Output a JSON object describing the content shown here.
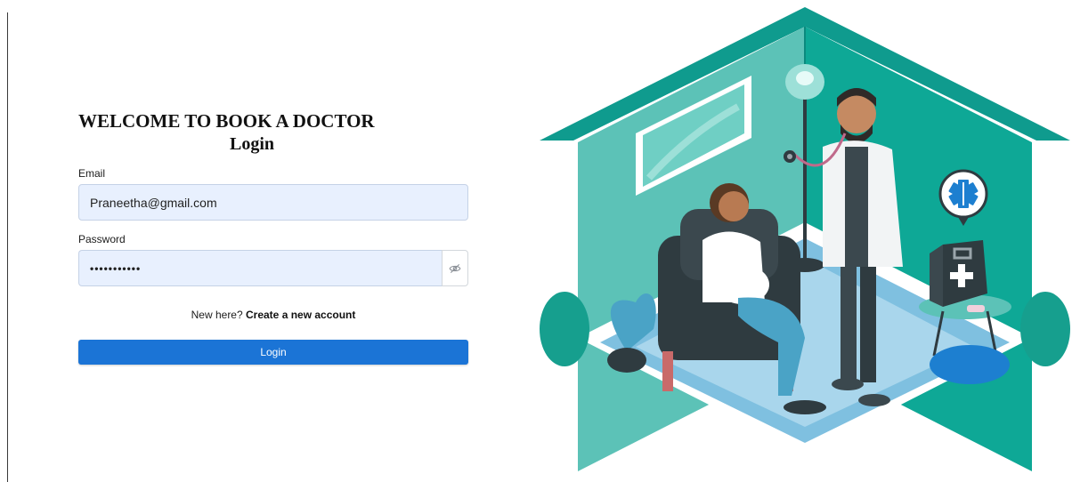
{
  "app": {
    "heading": "WELCOME TO BOOK A DOCTOR",
    "subheading": "Login"
  },
  "form": {
    "email_label": "Email",
    "email_value": "Praneetha@gmail.com",
    "password_label": "Password",
    "password_value": "Praneetha12",
    "signup_prompt": "New here?",
    "signup_link": "Create a new account",
    "login_label": "Login"
  },
  "illustration": {
    "icons": [
      "medical-star-icon",
      "first-aid-kit-icon",
      "stethoscope-icon"
    ]
  },
  "colors": {
    "accent": "#1b74d6",
    "input_bg": "#e8f0fe",
    "teal": "#0f9b8e",
    "teal_light": "#5cc2b7",
    "floor_blue": "#7fc0e0"
  }
}
